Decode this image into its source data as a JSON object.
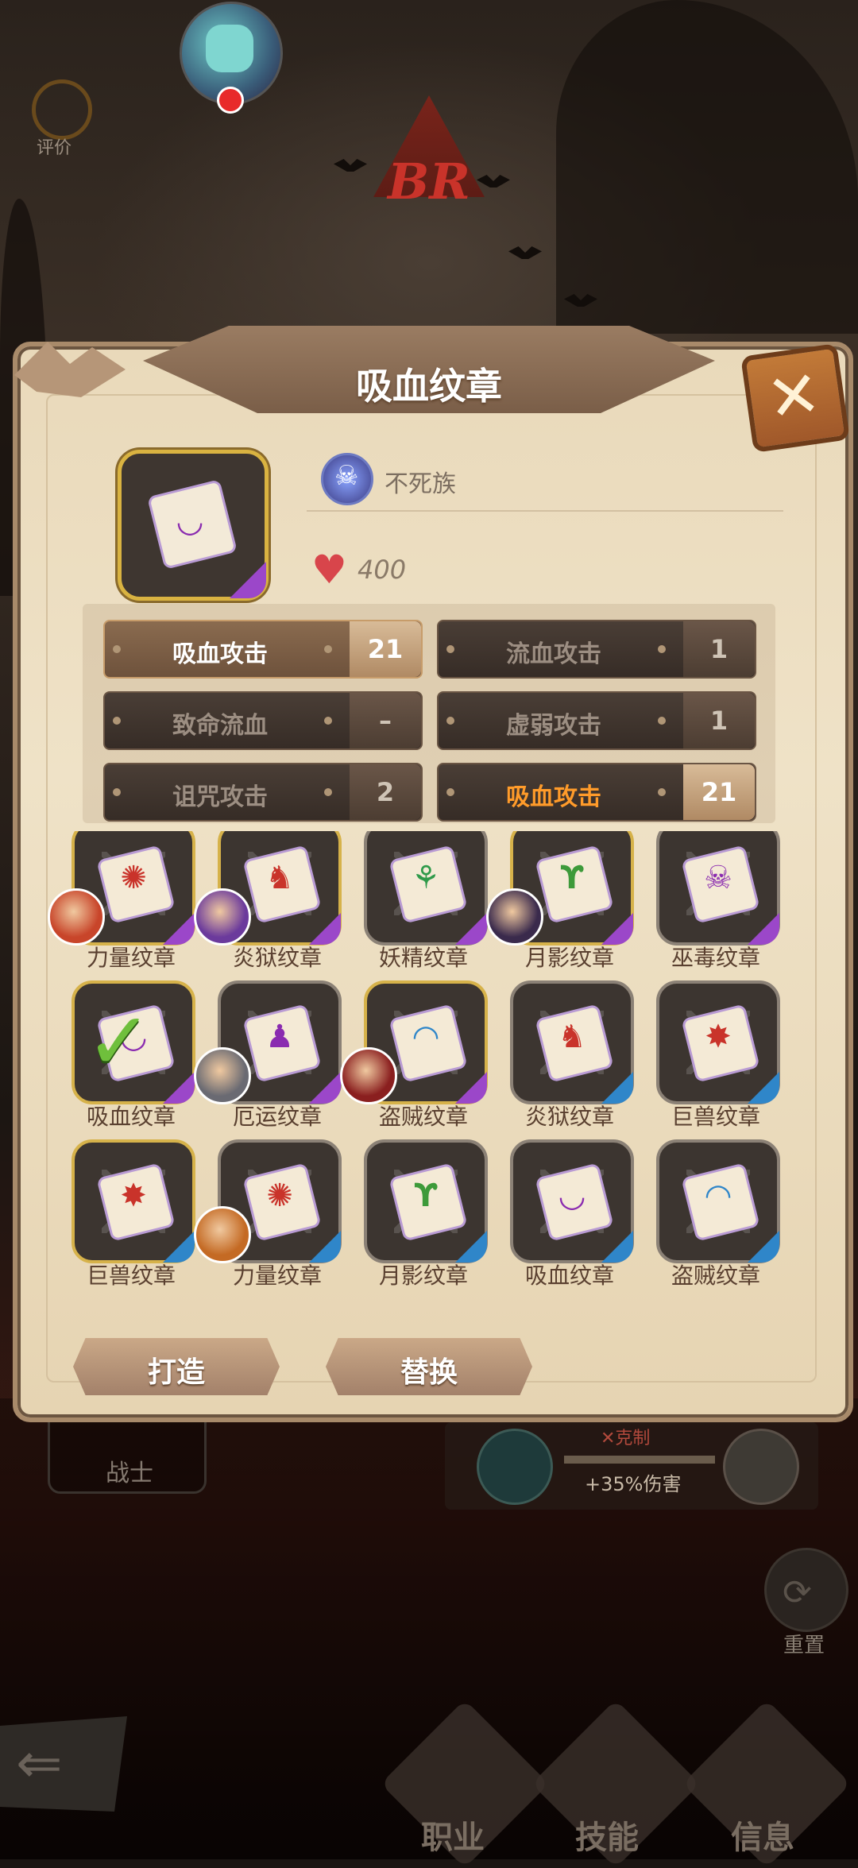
{
  "top": {
    "rate_label": "评价",
    "emblem_text": "BR"
  },
  "background": {
    "class_label": "战士",
    "counter_title": "✕克制",
    "counter_bonus": "+35%伤害",
    "reset_label": "重置",
    "nav": [
      "职业",
      "技能",
      "信息"
    ]
  },
  "modal": {
    "title": "吸血纹章",
    "race": "不死族",
    "hp": "400",
    "stats": [
      {
        "label": "吸血攻击",
        "value": "21",
        "state": "active"
      },
      {
        "label": "流血攻击",
        "value": "1",
        "state": "inactive"
      },
      {
        "label": "致命流血",
        "value": "–",
        "state": "inactive"
      },
      {
        "label": "虚弱攻击",
        "value": "1",
        "state": "inactive"
      },
      {
        "label": "诅咒攻击",
        "value": "2",
        "state": "inactive"
      },
      {
        "label": "吸血攻击",
        "value": "21",
        "state": "highlight"
      }
    ],
    "items": [
      {
        "name": "力量纹章",
        "icon": "strength-emblem-icon",
        "frame": "gold",
        "rarity_color": "#9b47c9",
        "hero": true,
        "hero_color": "#c8452a"
      },
      {
        "name": "炎狱纹章",
        "icon": "inferno-emblem-icon",
        "frame": "gold",
        "rarity_color": "#9b47c9",
        "hero": true,
        "hero_color": "#6b3a9c"
      },
      {
        "name": "妖精纹章",
        "icon": "fairy-emblem-icon",
        "frame": "silver",
        "rarity_color": "#9b47c9",
        "hero": false
      },
      {
        "name": "月影纹章",
        "icon": "moonshadow-emblem-icon",
        "frame": "gold",
        "rarity_color": "#9b47c9",
        "hero": true,
        "hero_color": "#3a2a4c"
      },
      {
        "name": "巫毒纹章",
        "icon": "voodoo-emblem-icon",
        "frame": "silver",
        "rarity_color": "#9b47c9",
        "hero": false
      },
      {
        "name": "吸血纹章",
        "icon": "vampire-emblem-icon",
        "frame": "gold",
        "rarity_color": "#9b47c9",
        "hero": false,
        "checked": true
      },
      {
        "name": "厄运纹章",
        "icon": "doom-emblem-icon",
        "frame": "silver",
        "rarity_color": "#9b47c9",
        "hero": true,
        "hero_color": "#6a6a72"
      },
      {
        "name": "盗贼纹章",
        "icon": "thief-emblem-icon",
        "frame": "gold",
        "rarity_color": "#9b47c9",
        "hero": true,
        "hero_color": "#8a1f1f"
      },
      {
        "name": "炎狱纹章",
        "icon": "inferno-emblem-icon",
        "frame": "silver",
        "rarity_color": "#2f86c9",
        "hero": false
      },
      {
        "name": "巨兽纹章",
        "icon": "beast-emblem-icon",
        "frame": "silver",
        "rarity_color": "#2f86c9",
        "hero": false
      },
      {
        "name": "巨兽纹章",
        "icon": "beast-emblem-icon",
        "frame": "gold",
        "rarity_color": "#2f86c9",
        "hero": false
      },
      {
        "name": "力量纹章",
        "icon": "strength-emblem-icon",
        "frame": "silver",
        "rarity_color": "#2f86c9",
        "hero": true,
        "hero_color": "#c46a24"
      },
      {
        "name": "月影纹章",
        "icon": "moonshadow-emblem-icon",
        "frame": "silver",
        "rarity_color": "#2f86c9",
        "hero": false
      },
      {
        "name": "吸血纹章",
        "icon": "vampire-emblem-icon",
        "frame": "silver",
        "rarity_color": "#2f86c9",
        "hero": false
      },
      {
        "name": "盗贼纹章",
        "icon": "thief-emblem-icon",
        "frame": "silver",
        "rarity_color": "#2f86c9",
        "hero": false
      }
    ],
    "buttons": {
      "forge": "打造",
      "replace": "替换"
    }
  }
}
